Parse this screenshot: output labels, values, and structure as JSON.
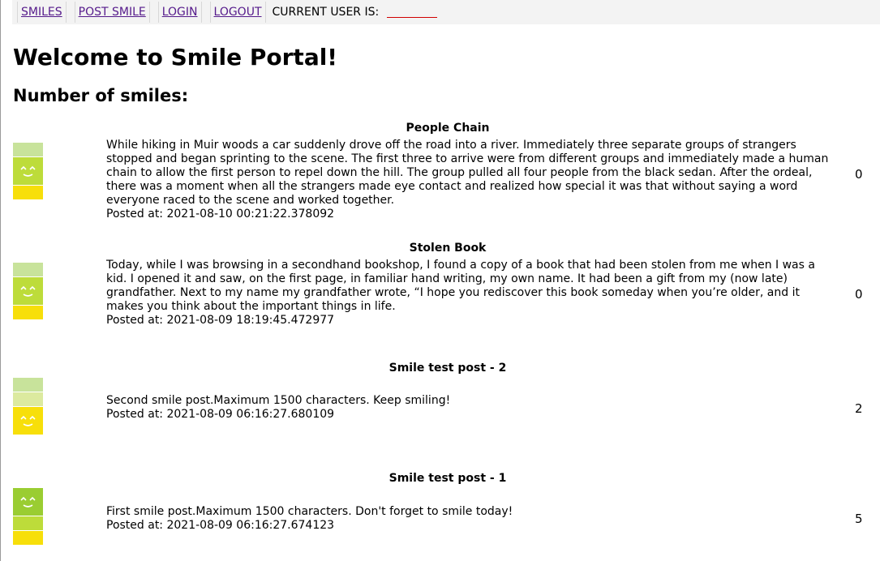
{
  "nav": {
    "smiles": "SMILES",
    "post_smile": "POST SMILE",
    "login": "LOGIN",
    "logout": "LOGOUT",
    "current_user_label": "CURRENT USER IS:"
  },
  "page": {
    "title": "Welcome to Smile Portal!",
    "subtitle": "Number of smiles:"
  },
  "colors": {
    "meter_top": "#c8e39b",
    "meter_mid": "#dcea9f",
    "meter_green": "#9acd32",
    "meter_lime": "#bddc3a",
    "meter_yellow": "#f7df0a"
  },
  "posts": [
    {
      "title": "People Chain",
      "body": "While hiking in Muir woods a car suddenly drove off the road into a river. Immediately three separate groups of strangers stopped and began sprinting to the scene. The first three to arrive were from different groups and immediately made a human chain to allow the first person to repel down the hill. The group pulled all four people from the black sedan. After the ordeal, there was a moment when all the strangers made eye contact and realized how special it was that without saying a word everyone raced to the scene and worked together.",
      "posted": "Posted at: 2021-08-10 00:21:22.378092",
      "count": "0"
    },
    {
      "title": "Stolen Book",
      "body": "Today, while I was browsing in a secondhand bookshop, I found a copy of a book that had been stolen from me when I was a kid. I opened it and saw, on the first page, in familiar hand writing, my own name. It had been a gift from my (now late) grandfather. Next to my name my grandfather wrote, “I hope you rediscover this book someday when you’re older, and it makes you think about the important things in life.",
      "posted": "Posted at: 2021-08-09 18:19:45.472977",
      "count": "0"
    },
    {
      "title": "Smile test post - 2",
      "body": "Second smile post.Maximum 1500 characters. Keep smiling!",
      "posted": "Posted at: 2021-08-09 06:16:27.680109",
      "count": "2"
    },
    {
      "title": "Smile test post - 1",
      "body": "First smile post.Maximum 1500 characters. Don't forget to smile today!",
      "posted": "Posted at: 2021-08-09 06:16:27.674123",
      "count": "5"
    }
  ]
}
